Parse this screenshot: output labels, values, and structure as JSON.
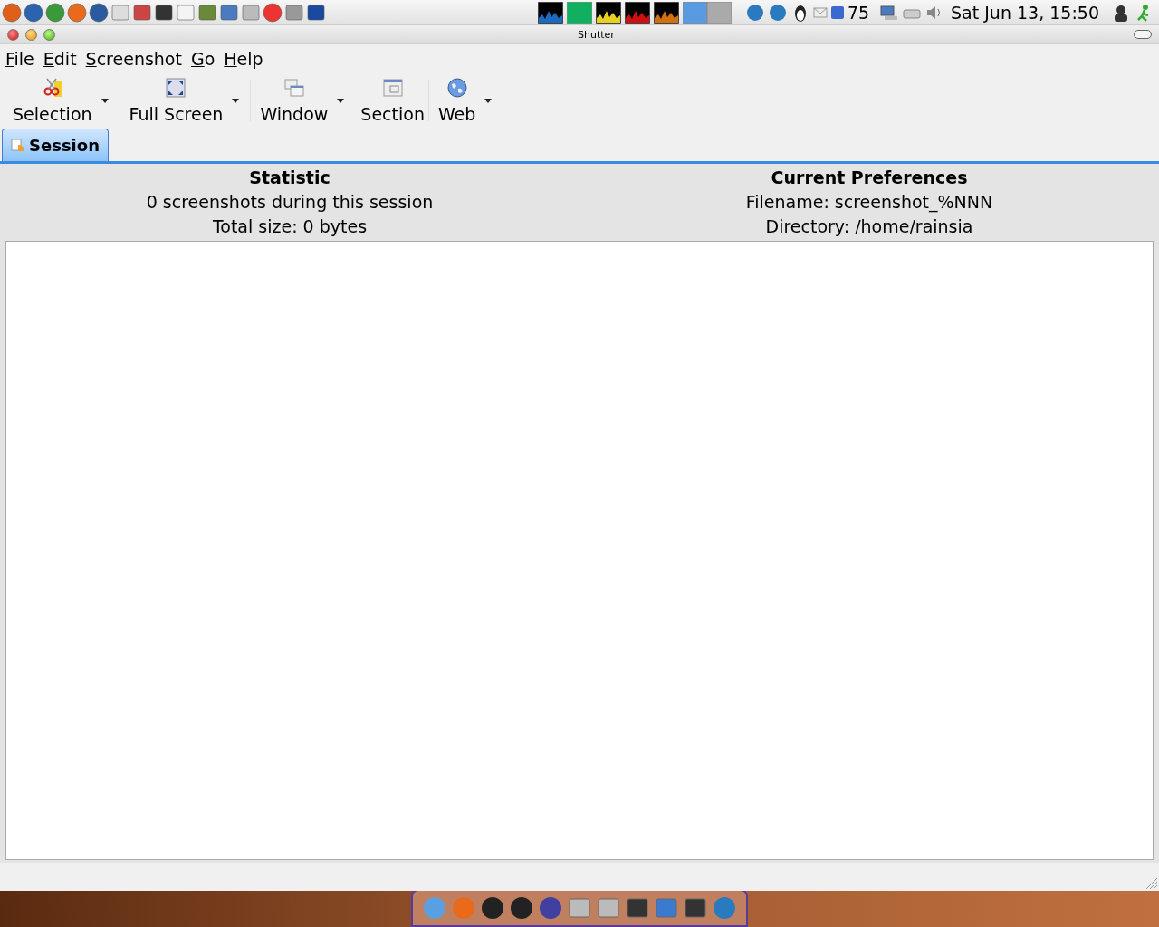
{
  "top_panel": {
    "mail_count": "75",
    "clock": "Sat Jun 13, 15:50"
  },
  "window": {
    "title": "Shutter"
  },
  "menu": [
    "File",
    "Edit",
    "Screenshot",
    "Go",
    "Help"
  ],
  "toolbar": [
    {
      "label": "Selection",
      "kind": "selection",
      "dropdown": true
    },
    {
      "label": "Full Screen",
      "kind": "fullscreen",
      "dropdown": true
    },
    {
      "label": "Window",
      "kind": "window",
      "dropdown": true
    },
    {
      "label": "Section",
      "kind": "section",
      "dropdown": false
    },
    {
      "label": "Web",
      "kind": "web",
      "dropdown": true
    }
  ],
  "tabs": [
    {
      "label": "Session",
      "selected": true
    }
  ],
  "statistic": {
    "heading": "Statistic",
    "lines": [
      "0 screenshots during this session",
      "Total size: 0 bytes"
    ]
  },
  "preferences": {
    "heading": "Current Preferences",
    "lines": [
      "Filename: screenshot_%NNN",
      "Directory: /home/rainsia"
    ]
  }
}
